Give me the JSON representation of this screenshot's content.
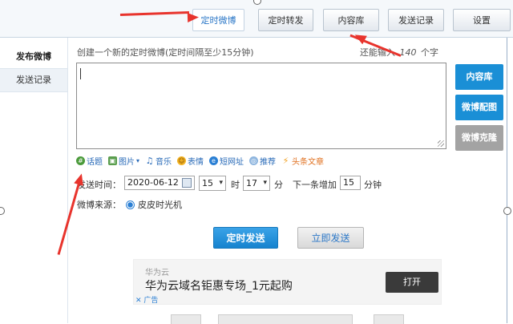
{
  "tabs": [
    {
      "label": "定时微博",
      "active": true
    },
    {
      "label": "定时转发",
      "active": false
    },
    {
      "label": "内容库",
      "active": false
    },
    {
      "label": "发送记录",
      "active": false
    },
    {
      "label": "设置",
      "active": false
    }
  ],
  "sidebar": {
    "items": [
      {
        "label": "发布微博",
        "active": true
      },
      {
        "label": "发送记录",
        "active": false
      }
    ]
  },
  "compose": {
    "hint": "创建一个新的定时微博(定时间隔至少15分钟)",
    "remaining_prefix": "还能输入",
    "remaining_count": "140",
    "remaining_suffix": "个字",
    "value": ""
  },
  "side_buttons": {
    "library": "内容库",
    "weibo_image": "微博配图",
    "weibo_clone": "微博克隆"
  },
  "toolbar": {
    "topic": "话题",
    "image": "图片",
    "music": "音乐",
    "emoji": "表情",
    "short_url": "短网址",
    "recommend": "推荐",
    "headline": "头条文章"
  },
  "schedule": {
    "label": "发送时间：",
    "date": "2020-06-12",
    "hour": "15",
    "hour_unit": "时",
    "minute": "17",
    "minute_unit": "分",
    "next_label": "下一条增加",
    "increment": "15",
    "increment_unit": "分钟"
  },
  "source": {
    "label": "微博来源：",
    "option": "皮皮时光机"
  },
  "actions": {
    "schedule": "定时发送",
    "send_now": "立即发送"
  },
  "ad": {
    "brand": "华为云",
    "headline": "华为云域名钜惠专场_1元起购",
    "cta": "打开",
    "tag": "广告"
  },
  "colors": {
    "accent_blue": "#1a8fd6",
    "clone_gray": "#a3a3a3",
    "annotation_red": "#e8342d"
  }
}
